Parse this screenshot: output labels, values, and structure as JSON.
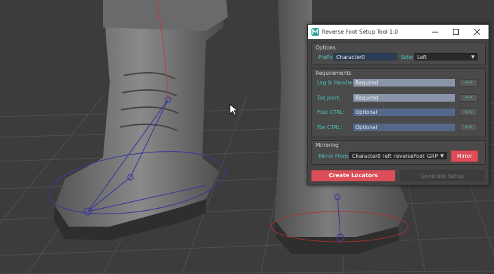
{
  "window": {
    "title": "Reverse Foot Setup Tool 1.0",
    "icon": "maya-app-icon",
    "controls": {
      "minimize": "minimize-icon",
      "maximize": "maximize-icon",
      "close": "close-icon"
    }
  },
  "options": {
    "title": "Options",
    "prefix_label": "Prefix:",
    "prefix_value": "Character0",
    "side_label": "Side:",
    "side_value": "Left"
  },
  "requirements": {
    "title": "Requirements",
    "rows": [
      {
        "label": "Leg Ik Handle:",
        "value": "Required",
        "button": "<<"
      },
      {
        "label": "Toe Joint:",
        "value": "Required",
        "button": "<<"
      },
      {
        "label": "Foot CTRL:",
        "value": "Optional",
        "button": "<<"
      },
      {
        "label": "Toe CTRL:",
        "value": "Optional",
        "button": "<<"
      }
    ]
  },
  "mirroring": {
    "title": "Mirroring",
    "from_label": "Mirror From:",
    "from_value": "Character0_left_reverseFoot_GRP",
    "mirror_button": "Mirror"
  },
  "actions": {
    "create": "Create Locators",
    "generate": "Generate Setup"
  },
  "colors": {
    "accent_red": "#dc4d56",
    "label_teal": "#4fc3bd",
    "panel": "#444444"
  }
}
